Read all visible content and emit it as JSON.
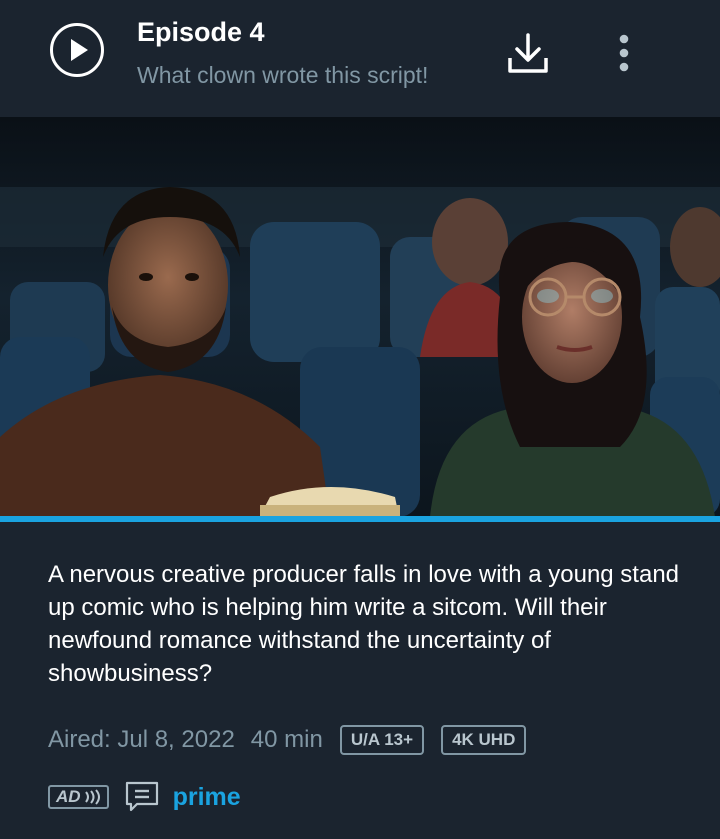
{
  "episode": {
    "title": "Episode 4",
    "subtitle": "What clown wrote this script!",
    "description": "A nervous creative producer falls in love with a young stand up comic who is helping him write a sitcom. Will their newfound romance withstand the uncertainty of showbusiness?",
    "aired": "Aired: Jul 8, 2022",
    "duration": "40 min",
    "rating_badge": "U/A 13+",
    "quality_badge": "4K UHD",
    "ad_badge": "AD",
    "service": "prime",
    "progress": 1.0
  },
  "icons": {
    "play": "play-icon",
    "download": "download-icon",
    "more": "more-vertical-icon",
    "subtitles": "subtitles-icon",
    "audio_description": "audio-description-icon"
  },
  "colors": {
    "background": "#1b242f",
    "accent": "#1aa3e0",
    "secondary_text": "#8197a4"
  }
}
